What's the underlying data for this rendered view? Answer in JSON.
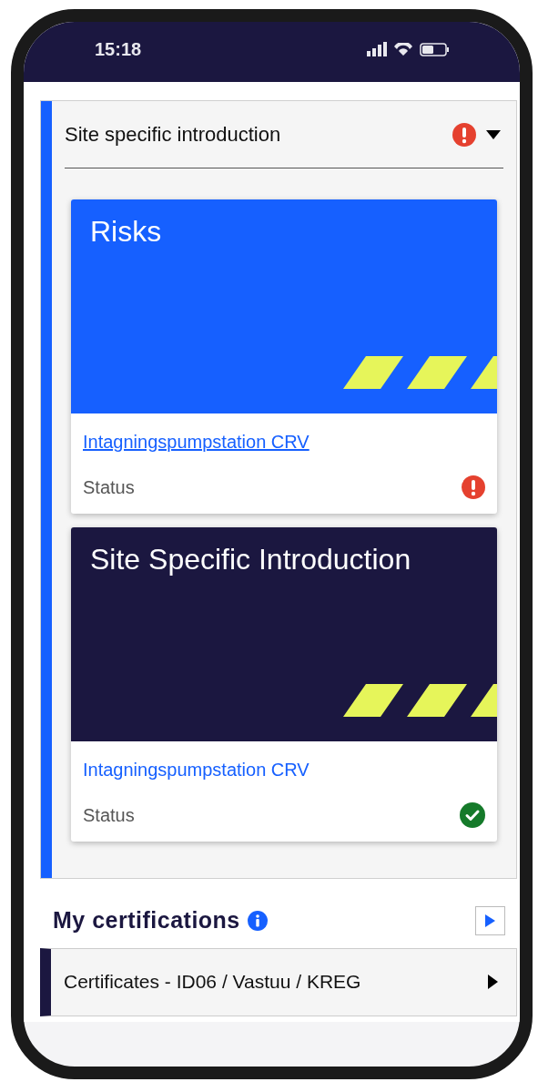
{
  "status_bar": {
    "time": "15:18"
  },
  "section": {
    "title": "Site specific introduction",
    "has_warning": true,
    "expanded": true,
    "cards": [
      {
        "title": "Risks",
        "color": "#1660ff",
        "link": "Intagningspumpstation CRV",
        "link_focused": true,
        "status_label": "Status",
        "completed": false
      },
      {
        "title": "Site Specific Introduction",
        "color": "#1b1740",
        "link": "Intagningspumpstation CRV",
        "link_focused": false,
        "status_label": "Status",
        "completed": true
      }
    ]
  },
  "certifications": {
    "title": "My certifications",
    "items": [
      {
        "label": "Certificates - ID06 / Vastuu / KREG"
      }
    ]
  }
}
